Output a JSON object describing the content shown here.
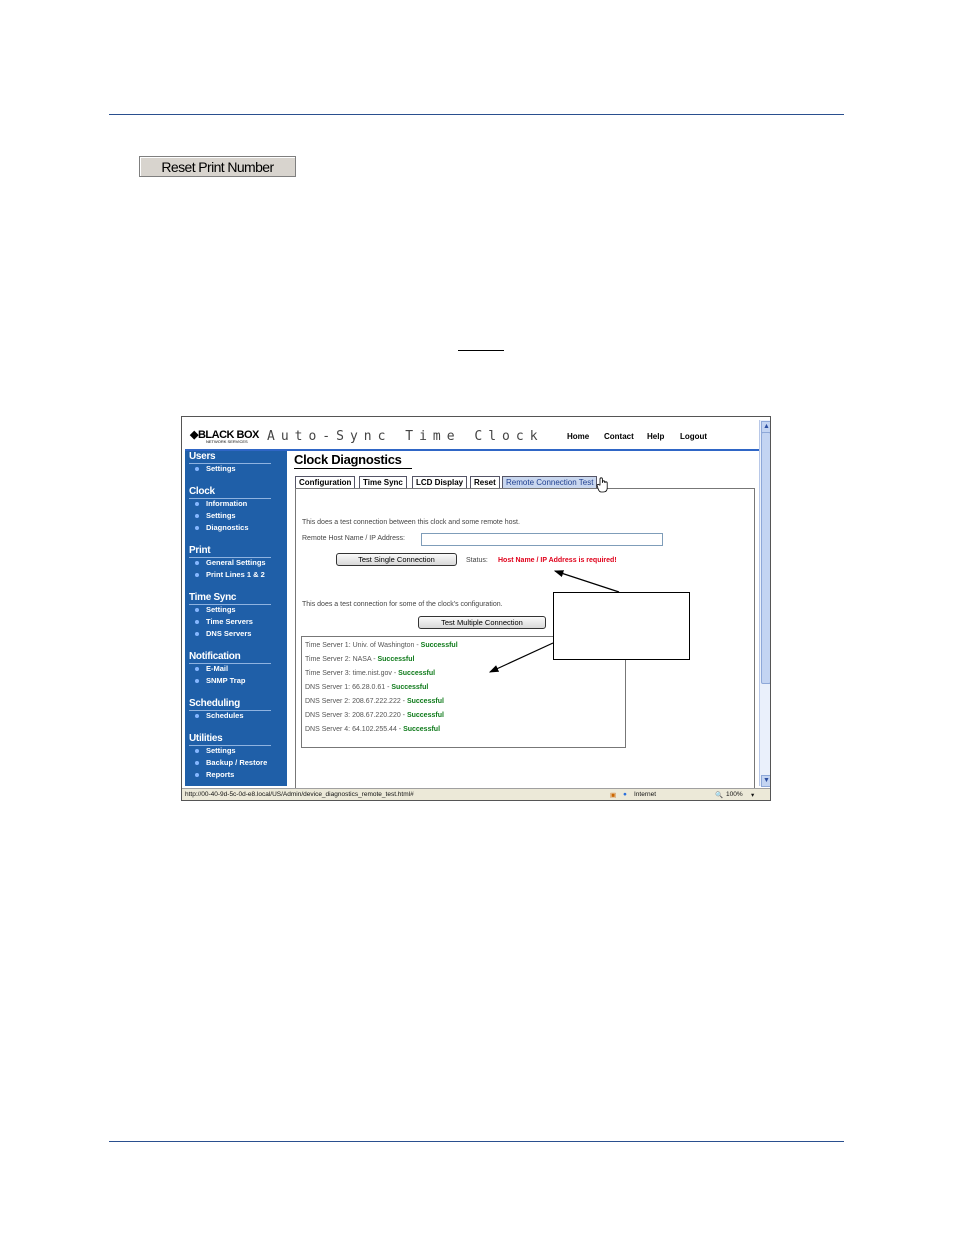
{
  "reset_button_label": "Reset Print Number",
  "app": {
    "logo": "BLACK BOX",
    "logo_sub": "NETWORK SERVICES",
    "title": "Auto-Sync Time Clock",
    "nav": {
      "home": "Home",
      "contact": "Contact",
      "help": "Help",
      "logout": "Logout"
    }
  },
  "sidebar": {
    "users": {
      "heading": "Users",
      "items": [
        "Settings"
      ]
    },
    "clock": {
      "heading": "Clock",
      "items": [
        "Information",
        "Settings",
        "Diagnostics"
      ]
    },
    "print": {
      "heading": "Print",
      "items": [
        "General Settings",
        "Print Lines 1 & 2"
      ]
    },
    "time_sync": {
      "heading": "Time Sync",
      "items": [
        "Settings",
        "Time Servers",
        "DNS Servers"
      ]
    },
    "notification": {
      "heading": "Notification",
      "items": [
        "E-Mail",
        "SNMP Trap"
      ]
    },
    "scheduling": {
      "heading": "Scheduling",
      "items": [
        "Schedules"
      ]
    },
    "utilities": {
      "heading": "Utilities",
      "items": [
        "Settings",
        "Backup / Restore",
        "Reports"
      ]
    }
  },
  "main": {
    "title": "Clock Diagnostics",
    "tabs": [
      "Configuration",
      "Time Sync",
      "LCD Display",
      "Reset",
      "Remote Connection Test"
    ],
    "single_desc": "This does a test connection between this clock and some remote host.",
    "host_label": "Remote Host Name / IP Address:",
    "host_value": "",
    "single_button": "Test Single Connection",
    "status_label": "Status:",
    "status_message": "Host Name / IP Address is required!",
    "multi_desc": "This does a test connection for some of the clock's configuration.",
    "multi_button": "Test Multiple Connection",
    "results": [
      {
        "label": "Time Server 1: Univ. of Washington - ",
        "result": "Successful"
      },
      {
        "label": "Time Server 2: NASA - ",
        "result": "Successful"
      },
      {
        "label": "Time Server 3: time.nist.gov - ",
        "result": "Successful"
      },
      {
        "label": "DNS Server 1: 66.28.0.61 - ",
        "result": "Successful"
      },
      {
        "label": "DNS Server 2: 208.67.222.222 - ",
        "result": "Successful"
      },
      {
        "label": "DNS Server 3: 208.67.220.220 - ",
        "result": "Successful"
      },
      {
        "label": "DNS Server 4: 64.102.255.44 - ",
        "result": "Successful"
      }
    ]
  },
  "statusbar": {
    "url": "http://00-40-9d-5c-0d-e8.local/US/Admin/device_diagnostics_remote_test.html#",
    "zone": "Internet",
    "zoom": "100%"
  },
  "colors": {
    "sidebar": "#1f5fa8",
    "success": "#0e7a1a",
    "error": "#e0001a",
    "rule": "#2a4f8f"
  }
}
